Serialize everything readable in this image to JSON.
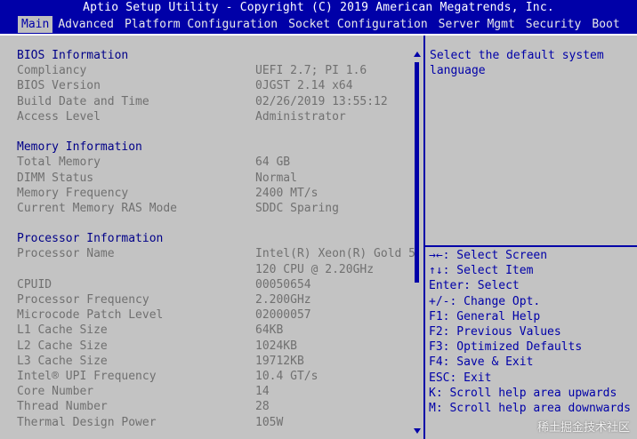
{
  "title": "Aptio Setup Utility - Copyright (C) 2019 American Megatrends, Inc.",
  "tabs": [
    "Main",
    "Advanced",
    "Platform Configuration",
    "Socket Configuration",
    "Server Mgmt",
    "Security",
    "Boot"
  ],
  "bios": {
    "heading": "BIOS Information",
    "items": [
      {
        "label": "Compliancy",
        "value": "UEFI 2.7; PI 1.6"
      },
      {
        "label": "BIOS Version",
        "value": "0JGST 2.14 x64"
      },
      {
        "label": "Build Date and Time",
        "value": "02/26/2019 13:55:12"
      },
      {
        "label": "Access Level",
        "value": "Administrator"
      }
    ]
  },
  "memory": {
    "heading": "Memory Information",
    "items": [
      {
        "label": "Total Memory",
        "value": "64 GB"
      },
      {
        "label": "DIMM Status",
        "value": "Normal"
      },
      {
        "label": "Memory Frequency",
        "value": "2400 MT/s"
      },
      {
        "label": "Current Memory RAS Mode",
        "value": "SDDC Sparing"
      }
    ]
  },
  "processor": {
    "heading": "Processor Information",
    "name_label": "Processor Name",
    "name_value_1": "Intel(R) Xeon(R) Gold 5",
    "name_value_2": "120 CPU @ 2.20GHz",
    "items": [
      {
        "label": "CPUID",
        "value": "00050654"
      },
      {
        "label": "Processor Frequency",
        "value": "2.200GHz"
      },
      {
        "label": "Microcode Patch Level",
        "value": "02000057"
      },
      {
        "label": "L1 Cache Size",
        "value": "64KB"
      },
      {
        "label": "L2 Cache Size",
        "value": "1024KB"
      },
      {
        "label": "L3 Cache Size",
        "value": "19712KB"
      },
      {
        "label": "Intel® UPI Frequency",
        "value": "10.4 GT/s"
      },
      {
        "label": "Core Number",
        "value": "14"
      },
      {
        "label": "Thread Number",
        "value": "28"
      },
      {
        "label": "Thermal Design Power",
        "value": "105W"
      }
    ]
  },
  "help": {
    "text": "Select the default system\nlanguage"
  },
  "keys": [
    "→←: Select Screen",
    "↑↓: Select Item",
    "Enter: Select",
    "+/-: Change Opt.",
    "F1: General Help",
    "F2: Previous Values",
    "F3: Optimized Defaults",
    "F4: Save & Exit",
    "ESC: Exit",
    "K: Scroll help area upwards",
    "M: Scroll help area downwards"
  ],
  "watermark": "稀土掘金技术社区",
  "colors": {
    "bg_blue": "#0000a8",
    "panel_gray": "#c3c3c3"
  }
}
